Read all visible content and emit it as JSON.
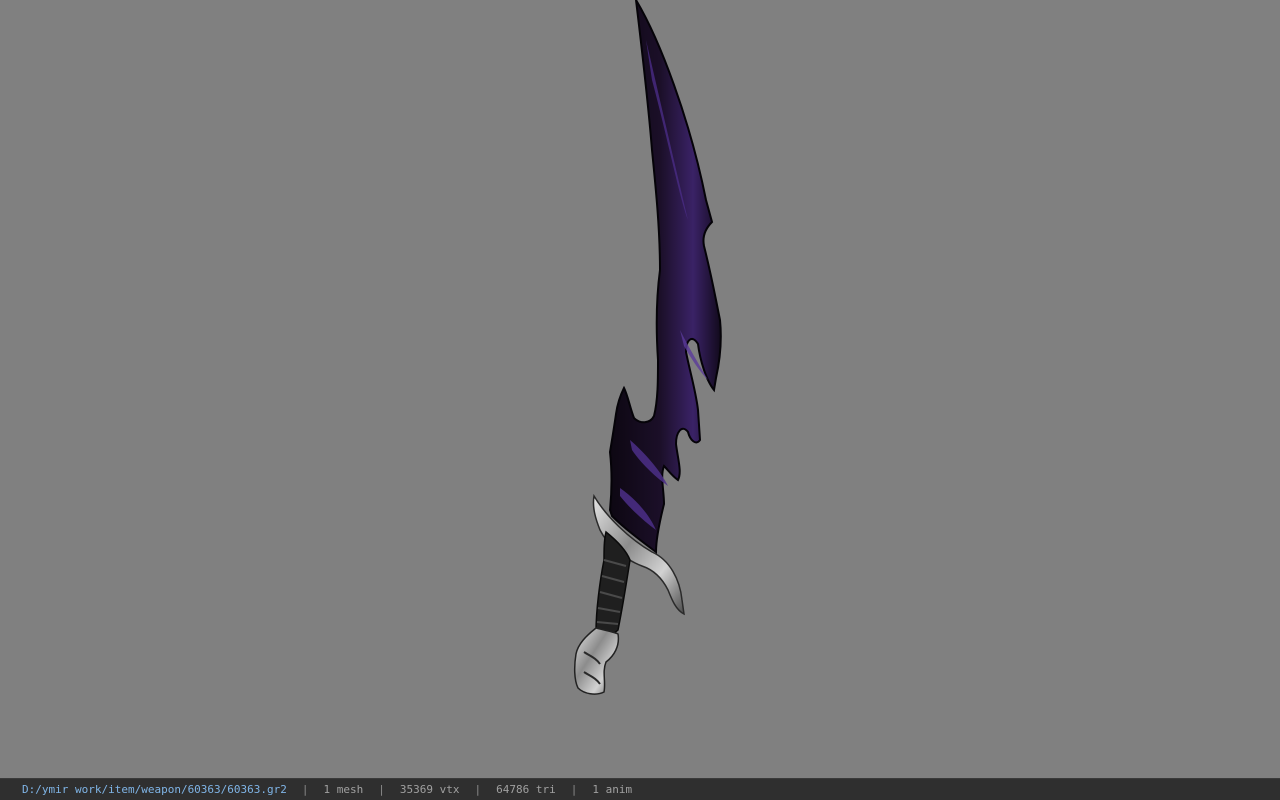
{
  "viewport": {
    "background_color": "#808080",
    "model": {
      "icon": "curved-sword-model",
      "blade_color": "#1a1024",
      "blade_edge_color": "#4a2a7a",
      "handle_color": "#2a2a2a",
      "metal_color": "#b8b8b8"
    }
  },
  "status_bar": {
    "file_path": "D:/ymir work/item/weapon/60363/60363.gr2",
    "separator": "|",
    "mesh_count": "1 mesh",
    "vertex_count": "35369 vtx",
    "triangle_count": "64786 tri",
    "anim_count": "1 anim",
    "path_color": "#7fb4e6"
  }
}
